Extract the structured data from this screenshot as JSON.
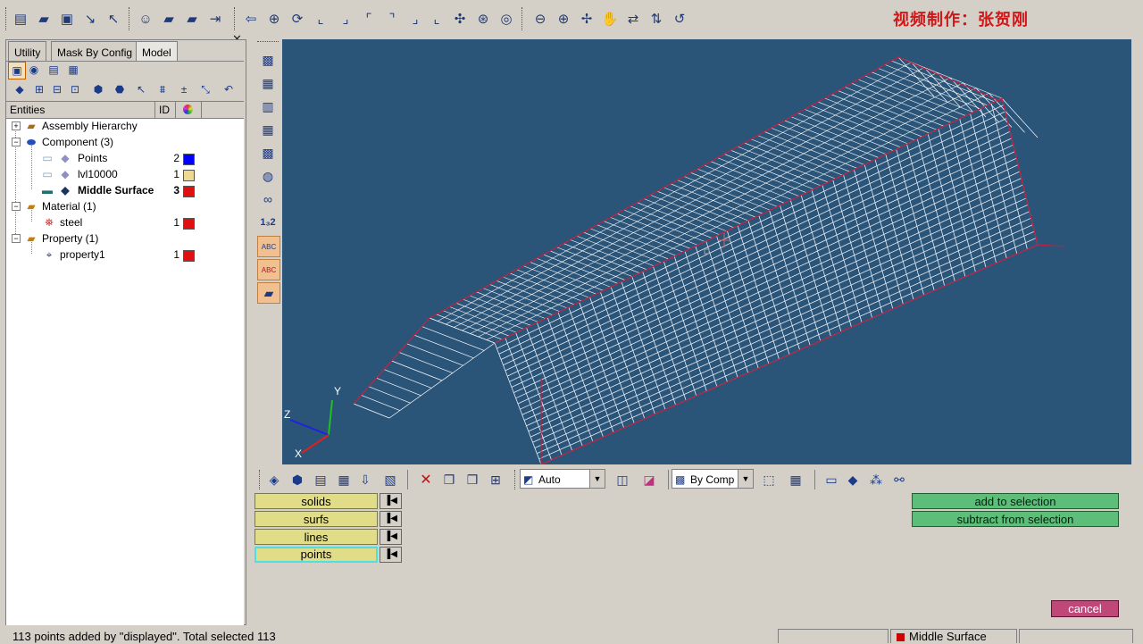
{
  "watermark": "视频制作：张贺刚",
  "toolbar_icons": [
    "new-file-icon",
    "open-folder-icon",
    "save-icon",
    "import-arrow-icon",
    "export-arrow-icon",
    "model-user-icon",
    "folder-open-icon",
    "folder-icon",
    "export-icon",
    "rotate-left-icon",
    "zoom-icon",
    "refresh-icon",
    "view-left-icon",
    "view-right-icon",
    "view-front-icon",
    "view-back-icon",
    "view-top-icon",
    "view-bottom-icon",
    "view-iso-icon",
    "rotate-icon",
    "find-icon",
    "zoom-in-icon",
    "zoom-out-icon",
    "pan-icon",
    "hand-icon",
    "flip-icon",
    "mirror-icon",
    "undo-view-icon"
  ],
  "tabs": [
    "Utility",
    "Mask By Config",
    "Model"
  ],
  "tree": {
    "headers": {
      "entities": "Entities",
      "id": "ID"
    },
    "rows": [
      {
        "label": "Assembly Hierarchy",
        "id": "",
        "color": ""
      },
      {
        "label": "Component (3)",
        "id": "",
        "color": ""
      },
      {
        "label": "Points",
        "id": "2",
        "color": "#0000ff"
      },
      {
        "label": "lvl10000",
        "id": "1",
        "color": "#f0d890"
      },
      {
        "label": "Middle Surface",
        "id": "3",
        "color": "#e01010"
      },
      {
        "label": "Material (1)",
        "id": "",
        "color": ""
      },
      {
        "label": "steel",
        "id": "1",
        "color": "#e01010"
      },
      {
        "label": "Property (1)",
        "id": "",
        "color": ""
      },
      {
        "label": "property1",
        "id": "1",
        "color": "#e01010"
      }
    ]
  },
  "bottom_toolbar": {
    "display_mode": "Auto",
    "color_mode": "By Comp"
  },
  "filters": [
    "solids",
    "surfs",
    "lines",
    "points"
  ],
  "actions": {
    "add": "add to selection",
    "subtract": "subtract from selection",
    "cancel": "cancel"
  },
  "axis_labels": {
    "x": "X",
    "y": "Y",
    "z": "Z"
  },
  "status": {
    "message": "113 points added by \"displayed\". Total selected 113",
    "component": "Middle Surface"
  }
}
